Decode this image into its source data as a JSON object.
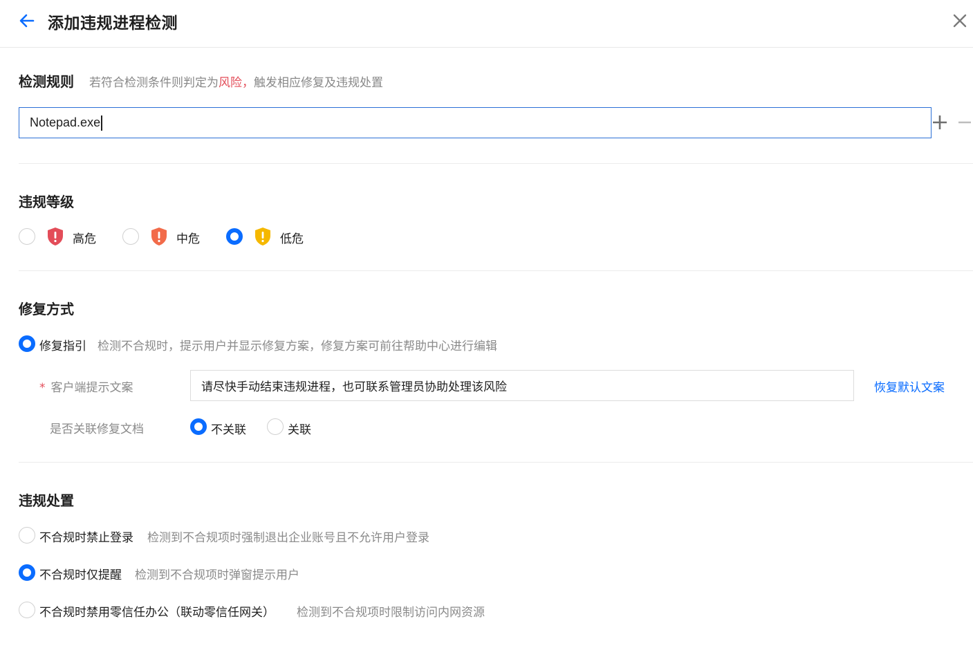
{
  "header": {
    "title": "添加违规进程检测"
  },
  "detection_rule": {
    "title": "检测规则",
    "desc_prefix": "若符合检测条件则判定为",
    "desc_risk": "风险，",
    "desc_suffix": "触发相应修复及违规处置",
    "input_value": "Notepad.exe"
  },
  "violation_level": {
    "title": "违规等级",
    "options": [
      {
        "label": "高危",
        "checked": false,
        "color": "#e34d59"
      },
      {
        "label": "中危",
        "checked": false,
        "color": "#f26b4a"
      },
      {
        "label": "低危",
        "checked": true,
        "color": "#f5b800"
      }
    ]
  },
  "repair": {
    "title": "修复方式",
    "option_label": "修复指引",
    "option_desc": "检测不合规时，提示用户并显示修复方案，修复方案可前往帮助中心进行编辑",
    "client_hint_label": "客户端提示文案",
    "required_mark": "*",
    "client_hint_value": "请尽快手动结束违规进程，也可联系管理员协助处理该风险",
    "restore_default_link": "恢复默认文案",
    "link_doc_label": "是否关联修复文档",
    "link_doc_options": [
      {
        "label": "不关联",
        "checked": true
      },
      {
        "label": "关联",
        "checked": false
      }
    ]
  },
  "disposal": {
    "title": "违规处置",
    "options": [
      {
        "label": "不合规时禁止登录",
        "desc": "检测到不合规项时强制退出企业账号且不允许用户登录",
        "checked": false
      },
      {
        "label": "不合规时仅提醒",
        "desc": "检测到不合规项时弹窗提示用户",
        "checked": true
      },
      {
        "label": "不合规时禁用零信任办公（联动零信任网关）",
        "desc": "检测到不合规项时限制访问内网资源",
        "checked": false
      }
    ]
  },
  "colors": {
    "primary": "#0a6cff",
    "danger": "#e34d59"
  }
}
